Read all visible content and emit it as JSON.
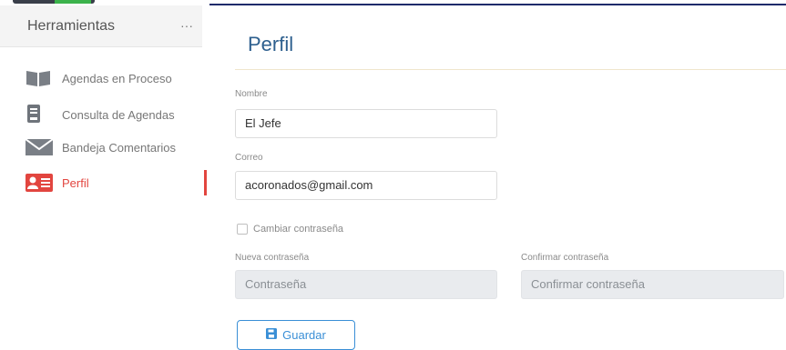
{
  "sidebar": {
    "title": "Herramientas",
    "more_label": "···",
    "items": [
      {
        "label": "Agendas en Proceso",
        "icon": "book-icon"
      },
      {
        "label": "Consulta de Agendas",
        "icon": "document-icon"
      },
      {
        "label": "Bandeja Comentarios",
        "icon": "envelope-icon"
      },
      {
        "label": "Perfil",
        "icon": "profile-card-icon"
      }
    ]
  },
  "main": {
    "title": "Perfil",
    "nombre": {
      "label": "Nombre",
      "value": "El Jefe"
    },
    "correo": {
      "label": "Correo",
      "value": "acoronados@gmail.com"
    },
    "cambiar_label": "Cambiar contraseña",
    "nueva": {
      "label": "Nueva contraseña",
      "placeholder": "Contraseña"
    },
    "confirmar": {
      "label": "Confirmar contraseña",
      "placeholder": "Confirmar contraseña"
    },
    "save_label": "Guardar"
  },
  "colors": {
    "accent": "#2d5f8e",
    "active": "#e2453f",
    "button": "#3a8fd6"
  }
}
